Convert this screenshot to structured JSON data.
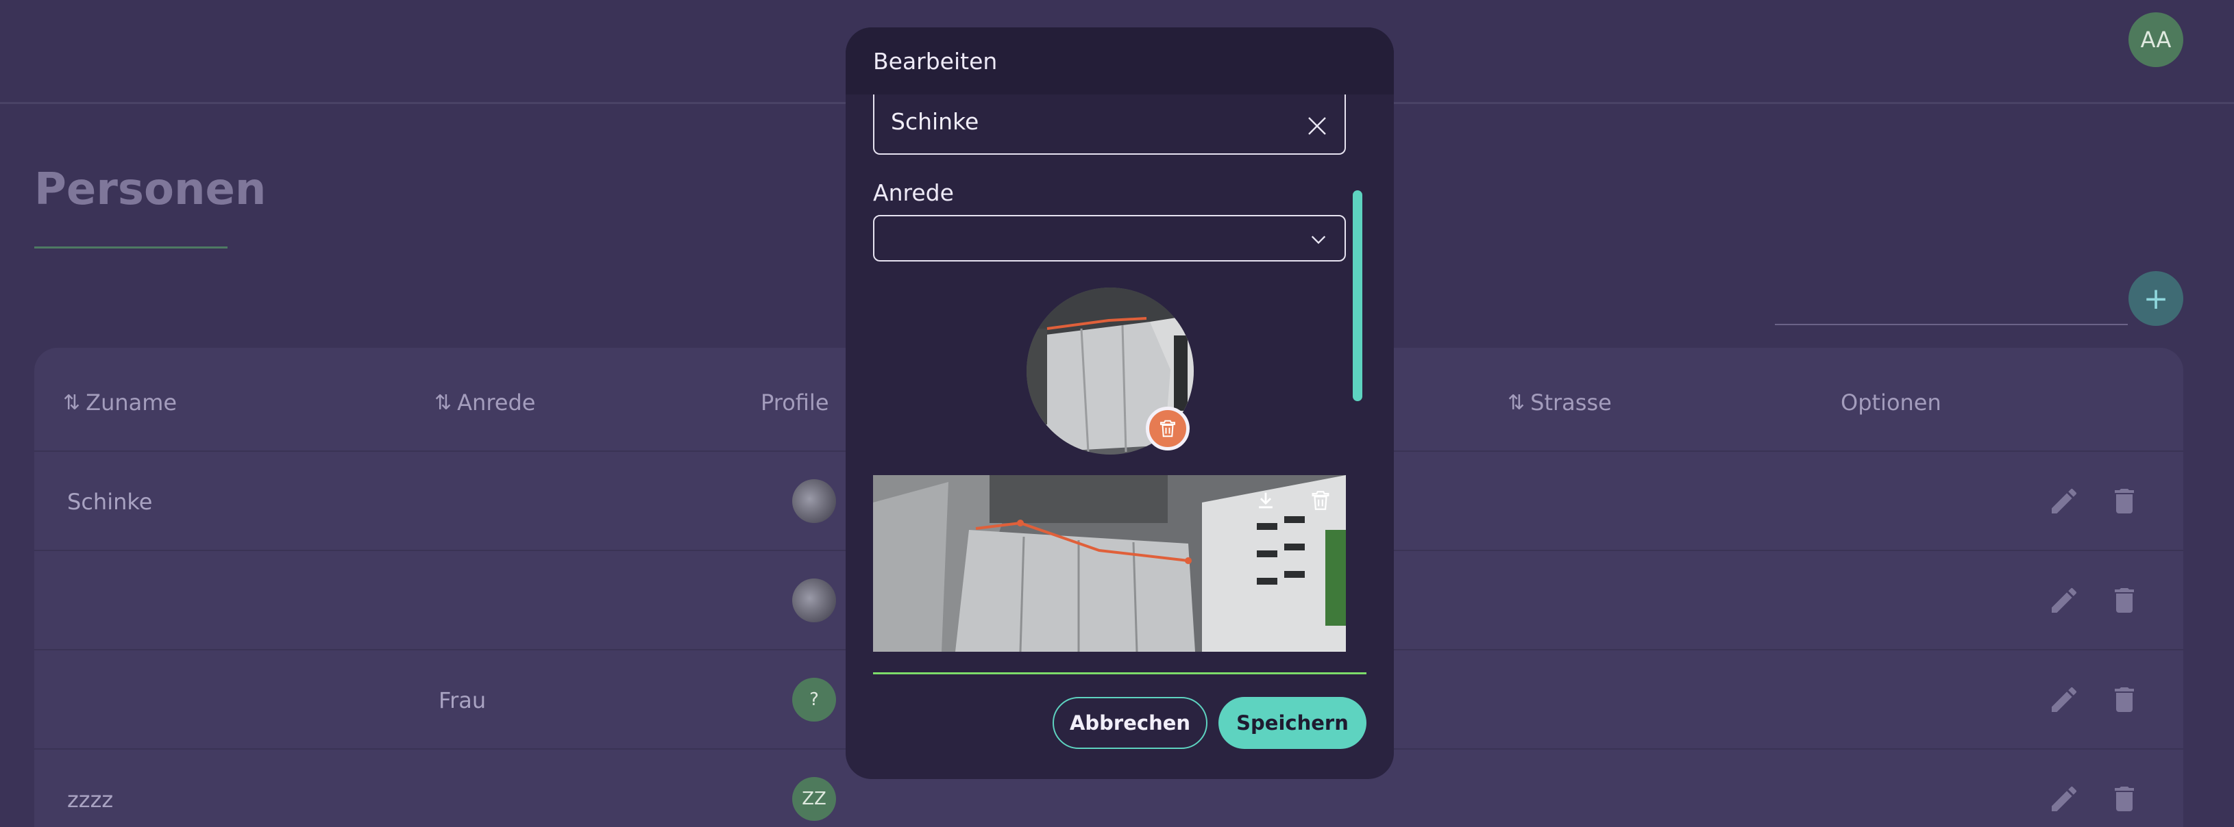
{
  "header": {
    "avatar_initials": "AA"
  },
  "page": {
    "title": "Personen"
  },
  "table": {
    "columns": [
      {
        "label": "Zuname",
        "sortable": true
      },
      {
        "label": "Anrede",
        "sortable": true
      },
      {
        "label": "Profile",
        "sortable": false
      },
      {
        "label": "Strasse",
        "sortable": true
      },
      {
        "label": "Optionen",
        "sortable": false
      }
    ],
    "rows": [
      {
        "zuname": "Schinke",
        "anrede": "",
        "profile": "photo",
        "initials": ""
      },
      {
        "zuname": "",
        "anrede": "",
        "profile": "photo",
        "initials": ""
      },
      {
        "zuname": "",
        "anrede": "Frau",
        "profile": "initials",
        "initials": "?"
      },
      {
        "zuname": "zzzz",
        "anrede": "",
        "profile": "initials",
        "initials": "ZZ"
      }
    ]
  },
  "modal": {
    "title": "Bearbeiten",
    "zuname_value": "Schinke",
    "anrede_label": "Anrede",
    "anrede_value": "",
    "cancel_label": "Abbrechen",
    "save_label": "Speichern"
  },
  "colors": {
    "accent": "#5ed3c0",
    "background": "#3b3357",
    "modal": "#2a2340",
    "delete_badge": "#e67b52",
    "avatar": "#4e7a5c"
  }
}
